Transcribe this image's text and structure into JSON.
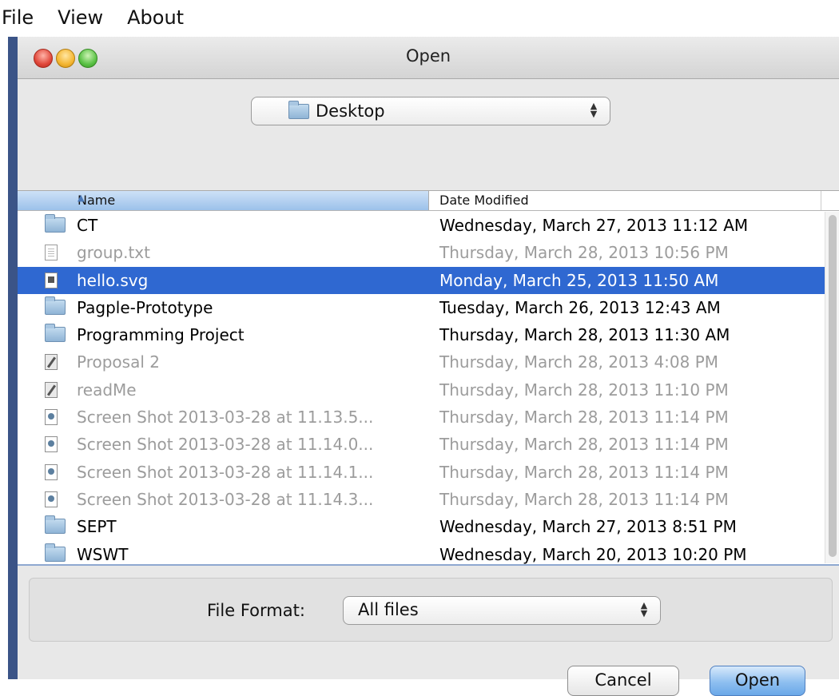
{
  "menubar": {
    "items": [
      "File",
      "View",
      "About"
    ]
  },
  "dialog": {
    "title": "Open",
    "location": {
      "label": "Desktop",
      "icon": "folder-icon"
    },
    "columns": {
      "name": "Name",
      "date": "Date Modified",
      "sort": "ascending"
    },
    "files": [
      {
        "name": "CT",
        "date": "Wednesday, March 27, 2013 11:12 AM",
        "icon": "folder-icon",
        "state": "normal"
      },
      {
        "name": "group.txt",
        "date": "Thursday, March 28, 2013 10:56 PM",
        "icon": "text-file-icon",
        "state": "dim"
      },
      {
        "name": "hello.svg",
        "date": "Monday, March 25, 2013 11:50 AM",
        "icon": "svg-file-icon",
        "state": "selected"
      },
      {
        "name": "Pagple-Prototype",
        "date": "Tuesday, March 26, 2013 12:43 AM",
        "icon": "folder-icon",
        "state": "normal"
      },
      {
        "name": "Programming Project",
        "date": "Thursday, March 28, 2013 11:30 AM",
        "icon": "folder-icon",
        "state": "normal"
      },
      {
        "name": "Proposal 2",
        "date": "Thursday, March 28, 2013 4:08 PM",
        "icon": "pages-doc-icon",
        "state": "dim"
      },
      {
        "name": "readMe",
        "date": "Thursday, March 28, 2013 11:10 PM",
        "icon": "pages-doc-icon",
        "state": "dim"
      },
      {
        "name": "Screen Shot 2013-03-28 at 11.13.5...",
        "date": "Thursday, March 28, 2013 11:14 PM",
        "icon": "image-file-icon",
        "state": "dim"
      },
      {
        "name": "Screen Shot 2013-03-28 at 11.14.0...",
        "date": "Thursday, March 28, 2013 11:14 PM",
        "icon": "image-file-icon",
        "state": "dim"
      },
      {
        "name": "Screen Shot 2013-03-28 at 11.14.1...",
        "date": "Thursday, March 28, 2013 11:14 PM",
        "icon": "image-file-icon",
        "state": "dim"
      },
      {
        "name": "Screen Shot 2013-03-28 at 11.14.3...",
        "date": "Thursday, March 28, 2013 11:14 PM",
        "icon": "image-file-icon",
        "state": "dim"
      },
      {
        "name": "SEPT",
        "date": "Wednesday, March 27, 2013 8:51 PM",
        "icon": "folder-icon",
        "state": "normal"
      },
      {
        "name": "WSWT",
        "date": "Wednesday, March 20, 2013 10:20 PM",
        "icon": "folder-icon",
        "state": "normal"
      }
    ],
    "format": {
      "label": "File Format:",
      "value": "All files"
    },
    "buttons": {
      "cancel": "Cancel",
      "open": "Open"
    }
  },
  "colors": {
    "selection": "#2f68d1",
    "dimmed_text": "#9c9c9c",
    "window_frame": "#3b5487"
  }
}
